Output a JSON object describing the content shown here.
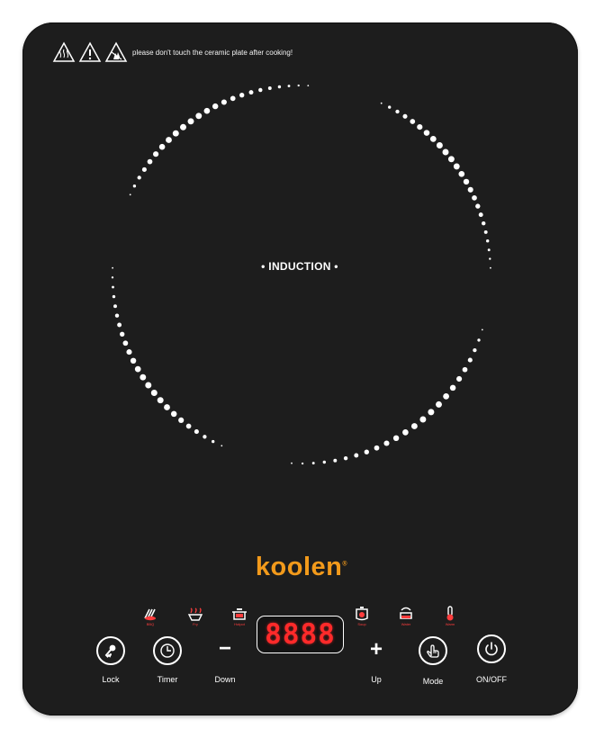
{
  "warning": {
    "text": "please don't touch the ceramic plate after cooking!",
    "icons": [
      "hot-surface-icon",
      "caution-icon",
      "no-touch-icon"
    ]
  },
  "hob": {
    "zone_label": "• INDUCTION •",
    "ring_color": "#ffffff"
  },
  "brand": {
    "name": "koolen",
    "registered_mark": "®",
    "color": "#f29a1b"
  },
  "modes": [
    {
      "label": "BBQ",
      "icon": "bbq-icon"
    },
    {
      "label": "Fry",
      "icon": "fry-icon"
    },
    {
      "label": "Hotpot",
      "icon": "hotpot-icon"
    },
    {
      "label": "Soup",
      "icon": "soup-icon"
    },
    {
      "label": "Water",
      "icon": "kettle-icon"
    },
    {
      "label": "Warm",
      "icon": "warm-icon"
    }
  ],
  "controls": {
    "lock_label": "Lock",
    "timer_label": "Timer",
    "down_label": "Down",
    "down_symbol": "−",
    "up_label": "Up",
    "up_symbol": "+",
    "mode_label": "Mode",
    "power_label": "ON/OFF",
    "display_value": "8888",
    "display_color": "#ff2a2a",
    "icon_color": "#ffffff",
    "mode_icon_color": "#ff3d3d"
  }
}
